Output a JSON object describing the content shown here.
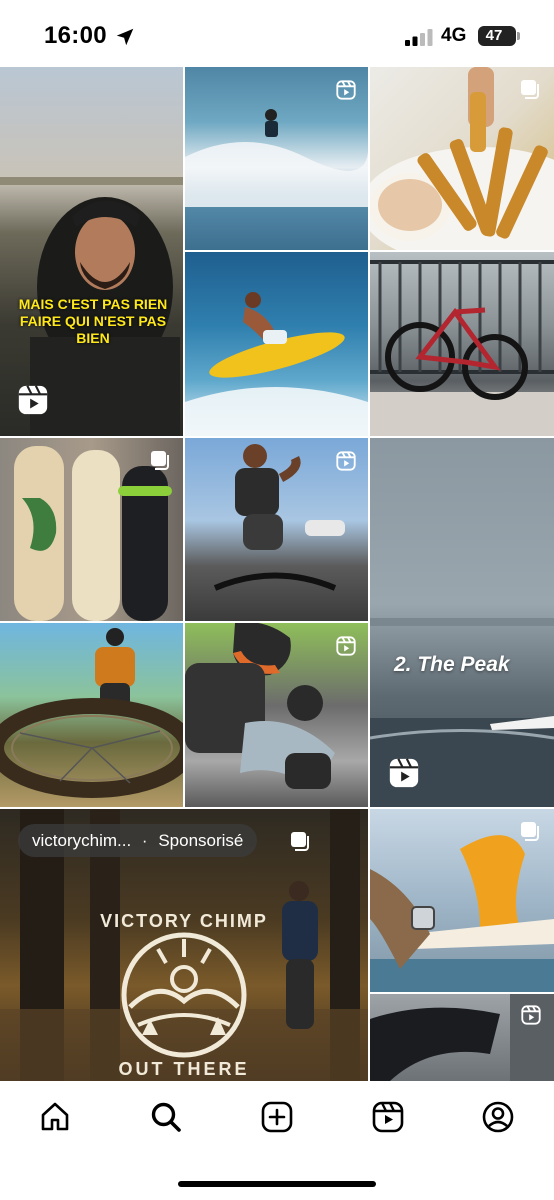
{
  "status": {
    "time": "16:00",
    "network": "4G",
    "battery": "47",
    "location_icon": "location-arrow-icon",
    "signal_icon": "signal-bars-icon"
  },
  "grid": {
    "tile1": {
      "caption_line1": "MAIS C'EST PAS RIEN",
      "caption_line2": "FAIRE QUI N'EST  PAS",
      "caption_line3": "BIEN",
      "badge": "reel-icon"
    },
    "tile2": {
      "badge": "reel-icon"
    },
    "tile3": {
      "badge": "multi-photo-icon"
    },
    "tile4": {},
    "tile5": {},
    "tile6": {
      "badge": "multi-photo-icon"
    },
    "tile7": {
      "badge": "reel-icon"
    },
    "tile8": {
      "caption": "2. The Peak",
      "badge": "reel-icon"
    },
    "tile9": {},
    "tile10": {
      "badge": "reel-icon"
    },
    "tile11": {
      "account": "victorychim...",
      "separator": "·",
      "sponsored_label": "Sponsorisé",
      "badge": "multi-photo-icon",
      "logo_text_top": "VICTORY CHIMP",
      "logo_text_bottom": "OUT THERE"
    },
    "tile12": {
      "badge": "multi-photo-icon"
    },
    "tile13": {
      "badge": "reel-icon"
    }
  },
  "bottom_nav": {
    "items": [
      {
        "icon": "home-icon"
      },
      {
        "icon": "search-icon"
      },
      {
        "icon": "create-icon"
      },
      {
        "icon": "reels-icon"
      },
      {
        "icon": "profile-icon"
      }
    ]
  }
}
